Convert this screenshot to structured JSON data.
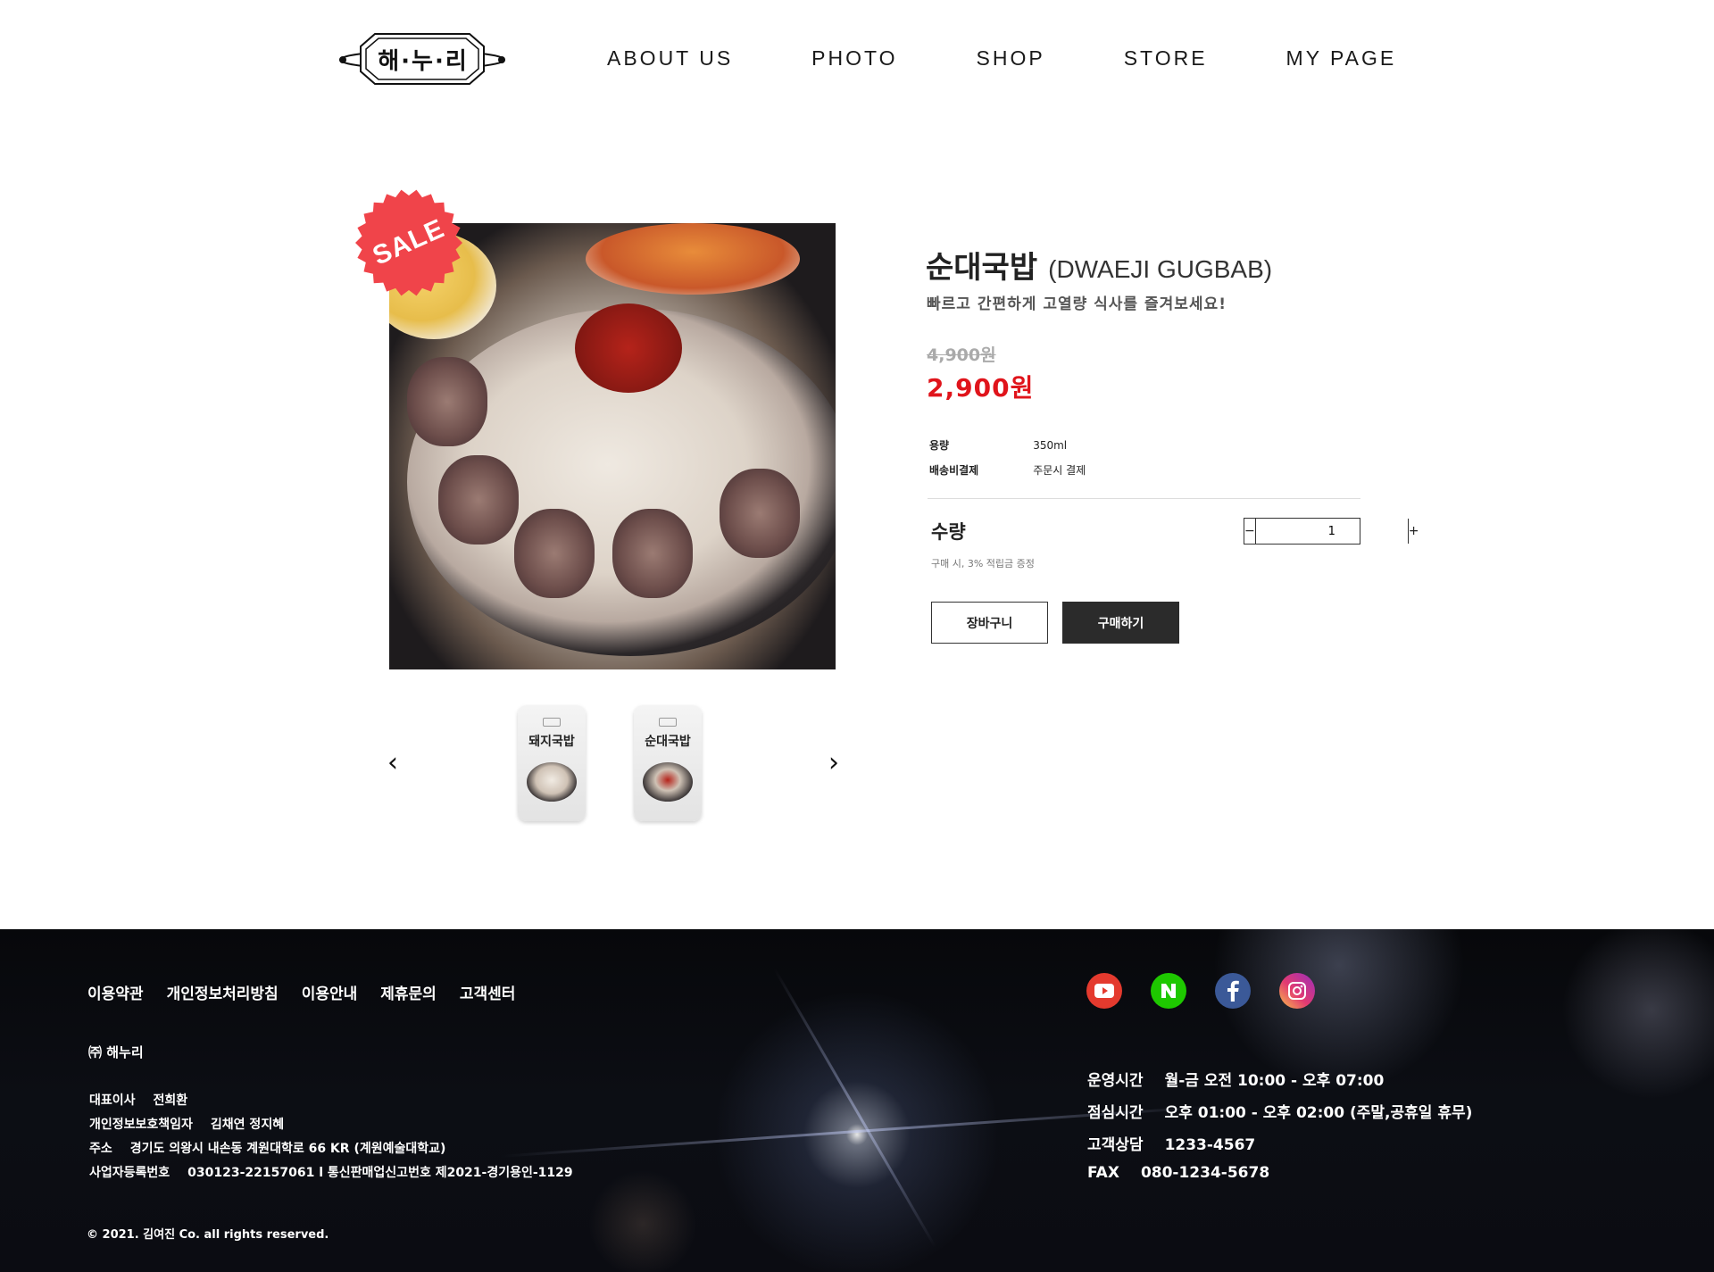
{
  "header": {
    "logo_text": "해·누·리",
    "nav": [
      "ABOUT US",
      "PHOTO",
      "SHOP",
      "STORE",
      "MY PAGE"
    ]
  },
  "product": {
    "badge": "SALE",
    "title_ko": "순대국밥",
    "title_en": "(DWAEJI GUGBAB)",
    "subtitle": "빠르고 간편하게 고열량 식사를 즐겨보세요!",
    "old_price": "4,900원",
    "new_price": "2,900원",
    "specs": [
      {
        "key": "용량",
        "value": "350ml"
      },
      {
        "key": "배송비결제",
        "value": "주문시 결제"
      }
    ],
    "qty_label": "수량",
    "qty_value": "1",
    "qty_minus": "−",
    "qty_plus": "+",
    "qty_note": "구매 시, 3% 적립금 증정",
    "cart_button": "장바구니",
    "buy_button": "구매하기",
    "thumbnails": [
      "돼지국밥",
      "순대국밥"
    ],
    "prev": "‹",
    "next": "›"
  },
  "footer": {
    "links": [
      "이용약관",
      "개인정보처리방침",
      "이용안내",
      "제휴문의",
      "고객센터"
    ],
    "company": "㈜ 해누리",
    "info": [
      {
        "k": "대표이사",
        "v": "전희환"
      },
      {
        "k": "개인정보보호책임자",
        "v": "김채연   정지혜"
      },
      {
        "k": "주소",
        "v": "경기도 의왕시 내손동 계원대학로 66 KR (계원예술대학교)"
      },
      {
        "k": "사업자등록번호",
        "v": "030123-22157061   l   통신판매업신고번호   제2021-경기용인-1129"
      }
    ],
    "copyright": "© 2021. 김여진 Co. all rights reserved.",
    "social": [
      "youtube-icon",
      "naver-icon",
      "facebook-icon",
      "instagram-icon"
    ],
    "hours": [
      {
        "k": "운영시간",
        "v": "월-금 오전 10:00 - 오후 07:00"
      },
      {
        "k": "점심시간",
        "v": "오후 01:00 - 오후 02:00 (주말,공휴일 휴무)"
      },
      {
        "k": "고객상담",
        "v": "1233-4567"
      },
      {
        "k": "FAX",
        "v": "080-1234-5678"
      }
    ]
  },
  "colors": {
    "sale_badge": "#f0444a",
    "price": "#e0141b",
    "buy_button": "#2b2b2b"
  }
}
